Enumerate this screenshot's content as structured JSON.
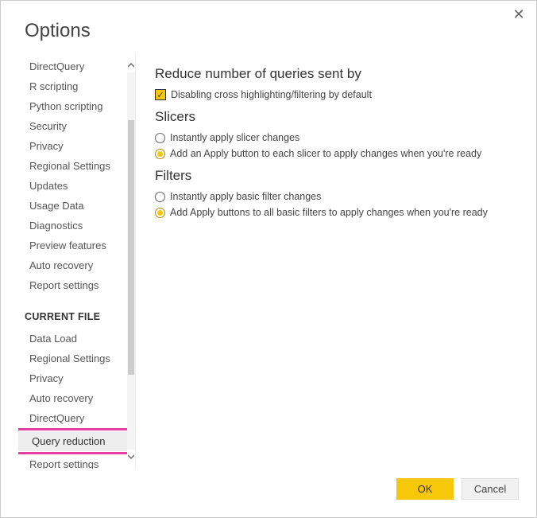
{
  "title": "Options",
  "sidebar": {
    "global_items": [
      "DirectQuery",
      "R scripting",
      "Python scripting",
      "Security",
      "Privacy",
      "Regional Settings",
      "Updates",
      "Usage Data",
      "Diagnostics",
      "Preview features",
      "Auto recovery",
      "Report settings"
    ],
    "current_header": "CURRENT FILE",
    "current_items": [
      "Data Load",
      "Regional Settings",
      "Privacy",
      "Auto recovery",
      "DirectQuery",
      "Query reduction",
      "Report settings"
    ],
    "selected_index": 5
  },
  "sections": {
    "reduce": {
      "title": "Reduce number of queries sent by",
      "checkbox_label": "Disabling cross highlighting/filtering by default",
      "checkbox_checked": true
    },
    "slicers": {
      "title": "Slicers",
      "opt1": "Instantly apply slicer changes",
      "opt2": "Add an Apply button to each slicer to apply changes when you're ready",
      "selected": 2
    },
    "filters": {
      "title": "Filters",
      "opt1": "Instantly apply basic filter changes",
      "opt2": "Add Apply buttons to all basic filters to apply changes when you're ready",
      "selected": 2
    }
  },
  "footer": {
    "ok": "OK",
    "cancel": "Cancel"
  }
}
